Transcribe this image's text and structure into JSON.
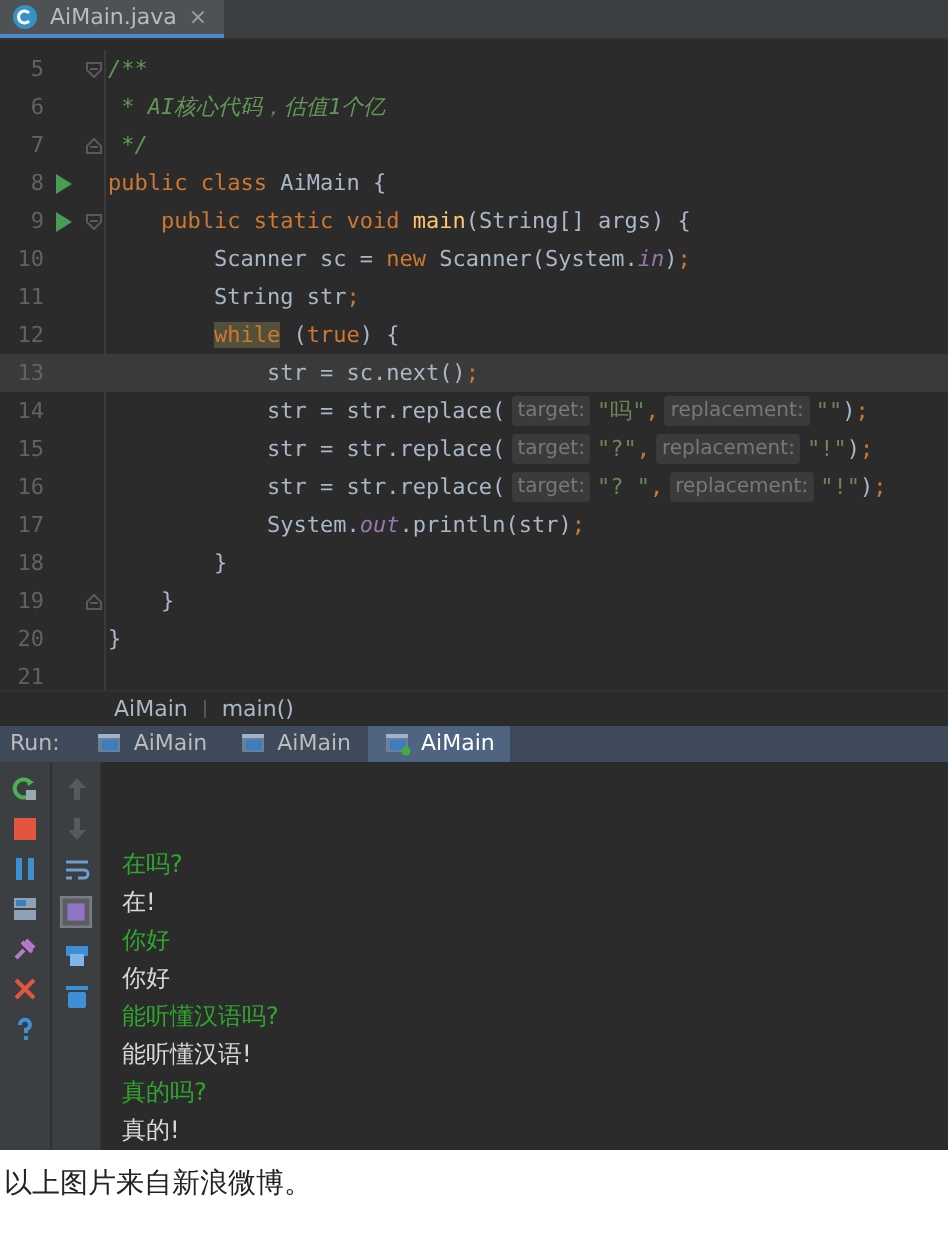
{
  "editor_tabs": [
    {
      "label": "AiMain.java",
      "close": "×",
      "selected": true
    }
  ],
  "code_lines": [
    {
      "number": "5",
      "run": false,
      "fold_start": true,
      "fold_end": false,
      "current": false,
      "tokens": [
        {
          "kind": "comment",
          "text": "/**"
        }
      ]
    },
    {
      "number": "6",
      "run": false,
      "fold_start": false,
      "fold_end": false,
      "current": false,
      "tokens": [
        {
          "kind": "comment",
          "text": " * AI核心代码，估值1个亿"
        }
      ]
    },
    {
      "number": "7",
      "run": false,
      "fold_start": false,
      "fold_end": true,
      "current": false,
      "tokens": [
        {
          "kind": "comment",
          "text": " */"
        }
      ]
    },
    {
      "number": "8",
      "run": true,
      "fold_start": false,
      "fold_end": false,
      "current": false,
      "tokens": [
        {
          "kind": "keyword",
          "text": "public class"
        },
        {
          "kind": "plain",
          "text": " AiMain {"
        }
      ]
    },
    {
      "number": "9",
      "run": true,
      "fold_start": true,
      "fold_end": false,
      "current": false,
      "tokens": [
        {
          "kind": "keyword",
          "text": "    public static void"
        },
        {
          "kind": "method",
          "text": " main"
        },
        {
          "kind": "plain",
          "text": "(String[] args) {"
        }
      ]
    },
    {
      "number": "10",
      "run": false,
      "fold_start": false,
      "fold_end": false,
      "current": false,
      "tokens": [
        {
          "kind": "plain",
          "text": "        Scanner sc = "
        },
        {
          "kind": "keyword",
          "text": "new"
        },
        {
          "kind": "plain",
          "text": " Scanner(System."
        },
        {
          "kind": "field",
          "text": "in"
        },
        {
          "kind": "plain",
          "text": ")"
        },
        {
          "kind": "keyword",
          "text": ";"
        }
      ]
    },
    {
      "number": "11",
      "run": false,
      "fold_start": false,
      "fold_end": false,
      "current": false,
      "tokens": [
        {
          "kind": "plain",
          "text": "        String str"
        },
        {
          "kind": "keyword",
          "text": ";"
        }
      ]
    },
    {
      "number": "12",
      "run": false,
      "fold_start": false,
      "fold_end": false,
      "current": false,
      "tokens": [
        {
          "kind": "keyword-marked",
          "text": "        while"
        },
        {
          "kind": "plain",
          "text": " ("
        },
        {
          "kind": "keyword",
          "text": "true"
        },
        {
          "kind": "plain",
          "text": ") {"
        }
      ]
    },
    {
      "number": "13",
      "run": false,
      "fold_start": false,
      "fold_end": false,
      "current": true,
      "tokens": [
        {
          "kind": "plain",
          "text": "            str = sc.next()"
        },
        {
          "kind": "keyword",
          "text": ";"
        }
      ]
    },
    {
      "number": "14",
      "run": false,
      "fold_start": false,
      "fold_end": false,
      "current": false,
      "tokens": [
        {
          "kind": "plain",
          "text": "            str = str.replace("
        },
        {
          "kind": "hint",
          "text": "target:"
        },
        {
          "kind": "string",
          "text": "\"吗\""
        },
        {
          "kind": "keyword",
          "text": ","
        },
        {
          "kind": "hint",
          "text": "replacement:"
        },
        {
          "kind": "string",
          "text": "\"\""
        },
        {
          "kind": "plain",
          "text": ")"
        },
        {
          "kind": "keyword",
          "text": ";"
        }
      ]
    },
    {
      "number": "15",
      "run": false,
      "fold_start": false,
      "fold_end": false,
      "current": false,
      "tokens": [
        {
          "kind": "plain",
          "text": "            str = str.replace("
        },
        {
          "kind": "hint",
          "text": "target:"
        },
        {
          "kind": "string",
          "text": "\"?\""
        },
        {
          "kind": "keyword",
          "text": ","
        },
        {
          "kind": "hint",
          "text": "replacement:"
        },
        {
          "kind": "string",
          "text": "\"!\""
        },
        {
          "kind": "plain",
          "text": ")"
        },
        {
          "kind": "keyword",
          "text": ";"
        }
      ]
    },
    {
      "number": "16",
      "run": false,
      "fold_start": false,
      "fold_end": false,
      "current": false,
      "tokens": [
        {
          "kind": "plain",
          "text": "            str = str.replace("
        },
        {
          "kind": "hint",
          "text": "target:"
        },
        {
          "kind": "string",
          "text": "\"? \""
        },
        {
          "kind": "keyword",
          "text": ","
        },
        {
          "kind": "hint",
          "text": "replacement:"
        },
        {
          "kind": "string",
          "text": "\"!\""
        },
        {
          "kind": "plain",
          "text": ")"
        },
        {
          "kind": "keyword",
          "text": ";"
        }
      ]
    },
    {
      "number": "17",
      "run": false,
      "fold_start": false,
      "fold_end": false,
      "current": false,
      "tokens": [
        {
          "kind": "plain",
          "text": "            System."
        },
        {
          "kind": "field",
          "text": "out"
        },
        {
          "kind": "plain",
          "text": ".println(str)"
        },
        {
          "kind": "keyword",
          "text": ";"
        }
      ]
    },
    {
      "number": "18",
      "run": false,
      "fold_start": false,
      "fold_end": false,
      "current": false,
      "tokens": [
        {
          "kind": "plain",
          "text": "        }"
        }
      ]
    },
    {
      "number": "19",
      "run": false,
      "fold_start": false,
      "fold_end": true,
      "current": false,
      "tokens": [
        {
          "kind": "plain",
          "text": "    }"
        }
      ]
    },
    {
      "number": "20",
      "run": false,
      "fold_start": false,
      "fold_end": false,
      "current": false,
      "tokens": [
        {
          "kind": "plain",
          "text": "}"
        }
      ]
    },
    {
      "number": "21",
      "run": false,
      "fold_start": false,
      "fold_end": false,
      "current": false
    }
  ],
  "breadcrumb": [
    "AiMain",
    "main()"
  ],
  "run_bar": {
    "label": "Run:",
    "tabs": [
      {
        "label": "AiMain",
        "selected": false
      },
      {
        "label": "AiMain",
        "selected": false
      },
      {
        "label": "AiMain",
        "selected": true
      }
    ]
  },
  "console": [
    {
      "kind": "input",
      "text": "在吗?"
    },
    {
      "kind": "output",
      "text": "在!"
    },
    {
      "kind": "input",
      "text": "你好"
    },
    {
      "kind": "output",
      "text": "你好"
    },
    {
      "kind": "input",
      "text": "能听懂汉语吗?"
    },
    {
      "kind": "output",
      "text": "能听懂汉语!"
    },
    {
      "kind": "input",
      "text": "真的吗?"
    },
    {
      "kind": "output",
      "text": "真的!"
    }
  ],
  "caption": "以上图片来自新浪微博。"
}
